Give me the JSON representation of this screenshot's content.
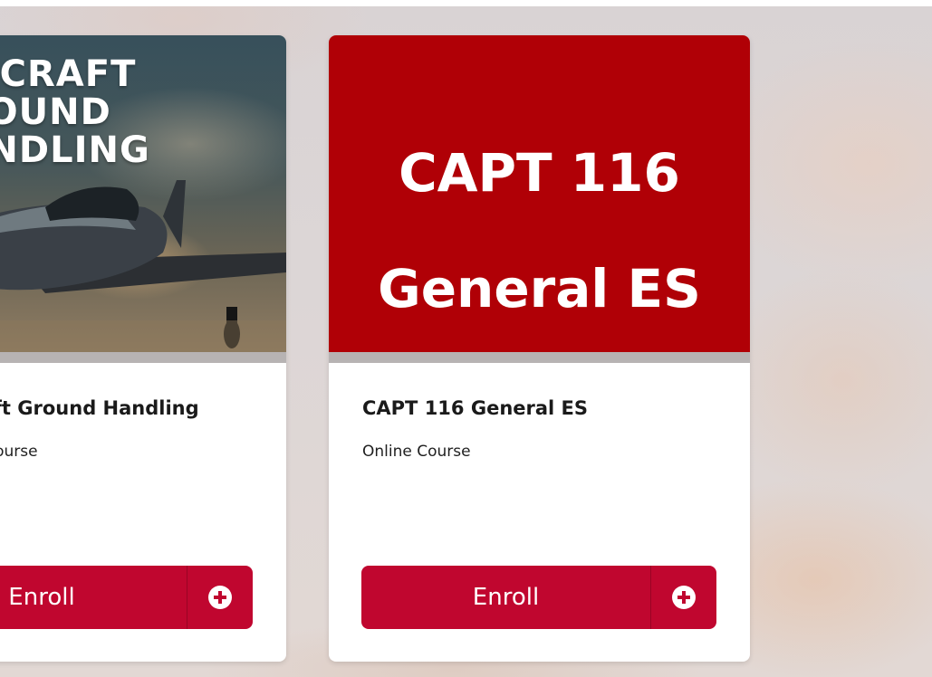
{
  "cards": [
    {
      "thumbnail_title": "AIRCRAFT GROUND\nHANDLING",
      "title": "Aircraft Ground Handling",
      "type": "Online Course",
      "enroll_label": "Enroll",
      "enroll_icon": "plus-circle-icon"
    },
    {
      "thumbnail_title": "CAPT 116\nGeneral ES",
      "title": "CAPT 116 General ES",
      "type": "Online Course",
      "enroll_label": "Enroll",
      "enroll_icon": "plus-circle-icon"
    }
  ],
  "colors": {
    "brand_red": "#b00006",
    "button_red": "#c0062f"
  }
}
